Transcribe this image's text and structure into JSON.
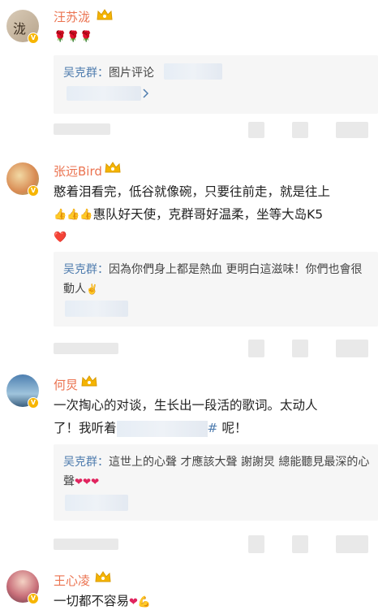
{
  "comments": [
    {
      "username": "汪苏泷",
      "avatar_text": "泷",
      "body": "🌹🌹🌹",
      "reply_prefix": "吴克群：",
      "reply_text": "图片评论"
    },
    {
      "username": "张远Bird",
      "body_line1": "憨着泪看完，低谷就像碗，只要往前走，就是往上",
      "body_line2": "惠队好天使，克群哥好温柔，坐等大岛K5",
      "body_heart": "❤️",
      "reply_prefix": "吴克群：",
      "reply_text": "因為你們身上都是熱血 更明白這滋味！你們也會很動人",
      "reply_emoji": "✌️"
    },
    {
      "username": "何炅",
      "body_line1": "一次掏心的对谈，生长出一段活的歌词。太动人",
      "body_line2_a": "了！我听着",
      "body_line2_hash": "#",
      "body_line2_b": "呢！",
      "reply_prefix": "吴克群：",
      "reply_text": "這世上的心聲 才應該大聲 謝謝炅 總能聽見最深的心聲",
      "reply_hearts": "❤❤❤"
    },
    {
      "username": "王心凌",
      "body": "一切都不容易",
      "body_heart": "❤",
      "body_emoji": "💪"
    }
  ],
  "colors": {
    "username": "#eb7350",
    "reply_name": "#507daf",
    "vip_badge": "#f7b500",
    "crown": "#f5b400"
  },
  "icons": [
    "crown-icon",
    "verified-badge-icon",
    "chevron-right-icon"
  ]
}
